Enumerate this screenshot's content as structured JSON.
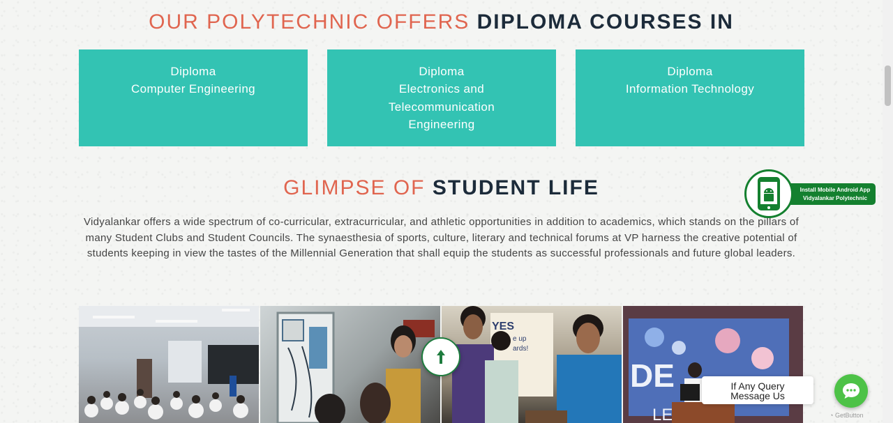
{
  "courses_heading": {
    "light": "OUR POLYTECHNIC OFFERS",
    "dark": "DIPLOMA COURSES IN"
  },
  "courses": [
    {
      "lines": [
        "Diploma",
        "Computer Engineering"
      ]
    },
    {
      "lines": [
        "Diploma",
        "Electronics and",
        "Telecommunication",
        "Engineering"
      ]
    },
    {
      "lines": [
        "Diploma",
        "Information Technology"
      ]
    }
  ],
  "life_heading": {
    "light": "GLIMPSE OF",
    "dark": "STUDENT LIFE"
  },
  "life_description": "Vidyalankar offers a wide spectrum of co-curricular, extracurricular, and athletic opportunities in addition to academics, which stands on the pillars of many Student Clubs and Student Councils. The synaesthesia of sports, culture, literary and technical forums at VP harness the creative potential of students keeping in view the tastes of the Millennial Generation that shall equip the students as successful professionals and future global leaders.",
  "gallery": [
    {
      "scene": "classroom"
    },
    {
      "scene": "electronics-lab"
    },
    {
      "scene": "project-exhibition",
      "sign_text": "YES",
      "sign_fragments": [
        "e up",
        "ards!"
      ]
    },
    {
      "scene": "seminar",
      "screen_text": [
        "DE",
        "LE"
      ]
    }
  ],
  "app_banner": {
    "line1": "Install Mobile Android App",
    "line2": "Vidyalankar Polytechnic",
    "icon": "android-phone-icon"
  },
  "query_widget": {
    "line1": "If Any Query",
    "line2": "Message Us"
  },
  "chat_button": {
    "icon": "chat-bubble-icon"
  },
  "getbutton_label": "GetButton",
  "back_to_top": {
    "icon": "arrow-up-icon"
  },
  "colors": {
    "accent": "#e0654f",
    "dark": "#1c2b3a",
    "teal": "#33c3b3",
    "green": "#14802f",
    "chat": "#4dc247"
  }
}
